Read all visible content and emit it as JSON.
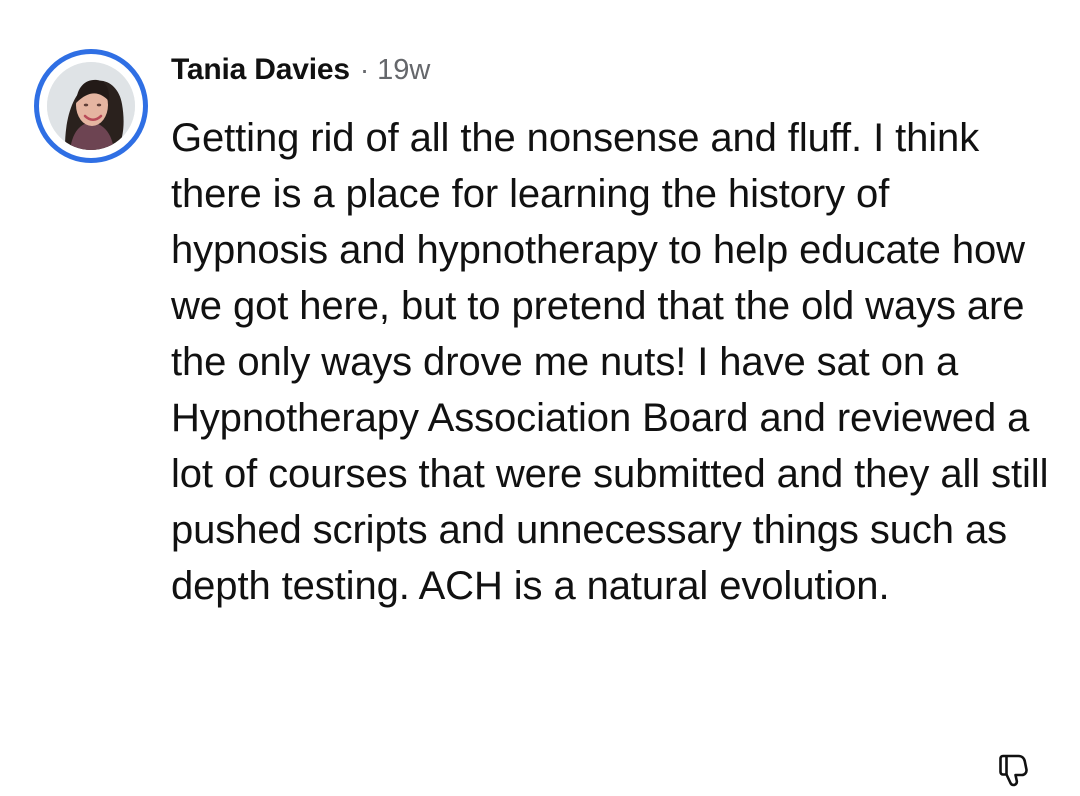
{
  "comment": {
    "author": "Tania Davies",
    "separator": "·",
    "timestamp": "19w",
    "text": "Getting rid of all the nonsense and fluff. I think there is a place for learning the history of hypnosis and hypnotherapy to help educate how we got here, but to pretend that the old ways are the only ways drove me nuts! I have sat on a Hypnotherapy Association Board and reviewed a lot of courses that were submitted and they all still pushed scripts and unnecessary things such as depth testing. ACH is a natural evolution.",
    "avatar_icon": "avatar-photo",
    "avatar_ring_color": "#2f6fe4",
    "action_icon": "thumbs-down-icon"
  }
}
